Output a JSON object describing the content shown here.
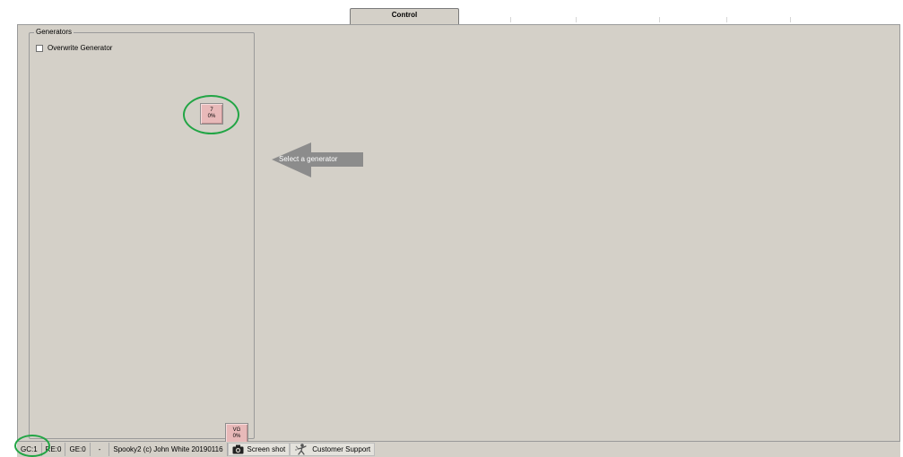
{
  "tabs": [
    {
      "label": "Control",
      "active": true
    }
  ],
  "generators_panel": {
    "title": "Generators",
    "overwrite_label": "Overwrite Generator",
    "overwrite_checked": false,
    "generator_buttons": [
      {
        "line1": "7",
        "line2": "0%"
      },
      {
        "line1": "VG",
        "line2": "0%"
      }
    ]
  },
  "hint": {
    "text": "Select a generator",
    "icon": "left-arrow-icon"
  },
  "status_bar": {
    "gc": "GC:1",
    "re": "RE:0",
    "ge": "GE:0",
    "dash": "-",
    "copyright": "Spooky2 (c) John White 20190116",
    "screenshot_label": "Screen shot",
    "screenshot_icon": "camera-icon",
    "support_label": "Customer Support",
    "support_icon": "support-person-icon"
  },
  "colors": {
    "panel_bg": "#d4d0c8",
    "generator_button": "#e8b9b9",
    "highlight_ring": "#22a545",
    "hint_arrow": "#8c8c8c"
  }
}
